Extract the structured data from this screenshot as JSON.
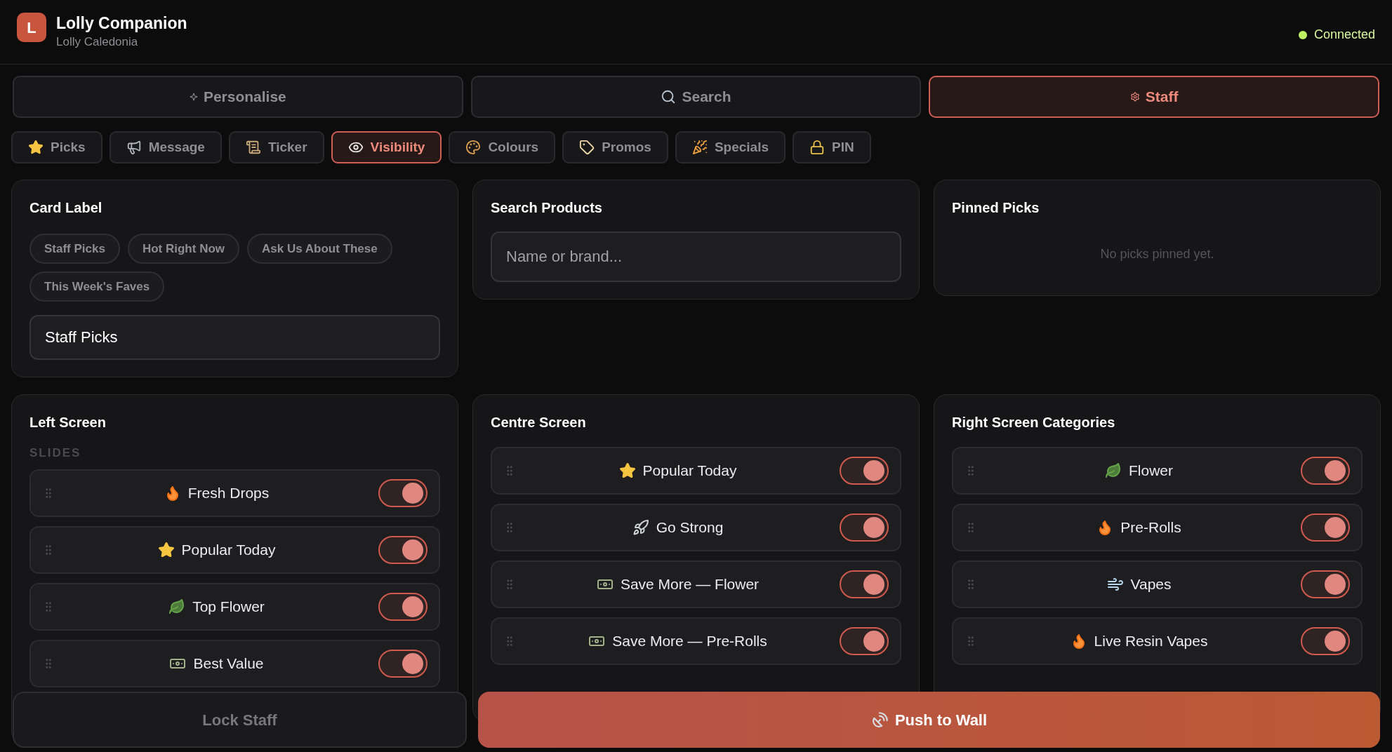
{
  "app": {
    "logo": "L",
    "title": "Lolly Companion",
    "subtitle": "Lolly Caledonia",
    "status": {
      "label": "Connected",
      "connected": true
    }
  },
  "mode_tabs": [
    {
      "label": "Personalise",
      "selected": false
    },
    {
      "label": "Search",
      "selected": false
    },
    {
      "label": "Staff",
      "selected": true
    }
  ],
  "sub_tabs": [
    {
      "label": "Picks",
      "selected": false
    },
    {
      "label": "Message",
      "selected": false
    },
    {
      "label": "Ticker",
      "selected": false
    },
    {
      "label": "Visibility",
      "selected": true
    },
    {
      "label": "Colours",
      "selected": false
    },
    {
      "label": "Promos",
      "selected": false
    },
    {
      "label": "Specials",
      "selected": false
    },
    {
      "label": "PIN",
      "selected": false
    }
  ],
  "card_label": {
    "title": "Card Label",
    "presets": [
      "Staff Picks",
      "Hot Right Now",
      "Ask Us About These",
      "This Week's Faves"
    ],
    "value": "Staff Picks"
  },
  "search_products": {
    "title": "Search Products",
    "placeholder": "Name or brand..."
  },
  "pinned_picks": {
    "title": "Pinned Picks",
    "empty_text": "No picks pinned yet."
  },
  "screens": [
    {
      "title": "Left Screen",
      "section": "SLIDES",
      "items": [
        {
          "label": "Fresh Drops",
          "on": true
        },
        {
          "label": "Popular Today",
          "on": true
        },
        {
          "label": "Top Flower",
          "on": true
        },
        {
          "label": "Best Value",
          "on": true
        }
      ]
    },
    {
      "title": "Centre Screen",
      "items": [
        {
          "label": "Popular Today",
          "on": true
        },
        {
          "label": "Go Strong",
          "on": true
        },
        {
          "label": "Save More — Flower",
          "on": true
        },
        {
          "label": "Save More — Pre-Rolls",
          "on": true
        }
      ]
    },
    {
      "title": "Right Screen Categories",
      "items": [
        {
          "label": "Flower",
          "on": true
        },
        {
          "label": "Pre-Rolls",
          "on": true
        },
        {
          "label": "Vapes",
          "on": true
        },
        {
          "label": "Live Resin Vapes",
          "on": true
        }
      ]
    }
  ],
  "footer": {
    "lock_button": "Lock Staff",
    "push_button": "Push to Wall"
  }
}
